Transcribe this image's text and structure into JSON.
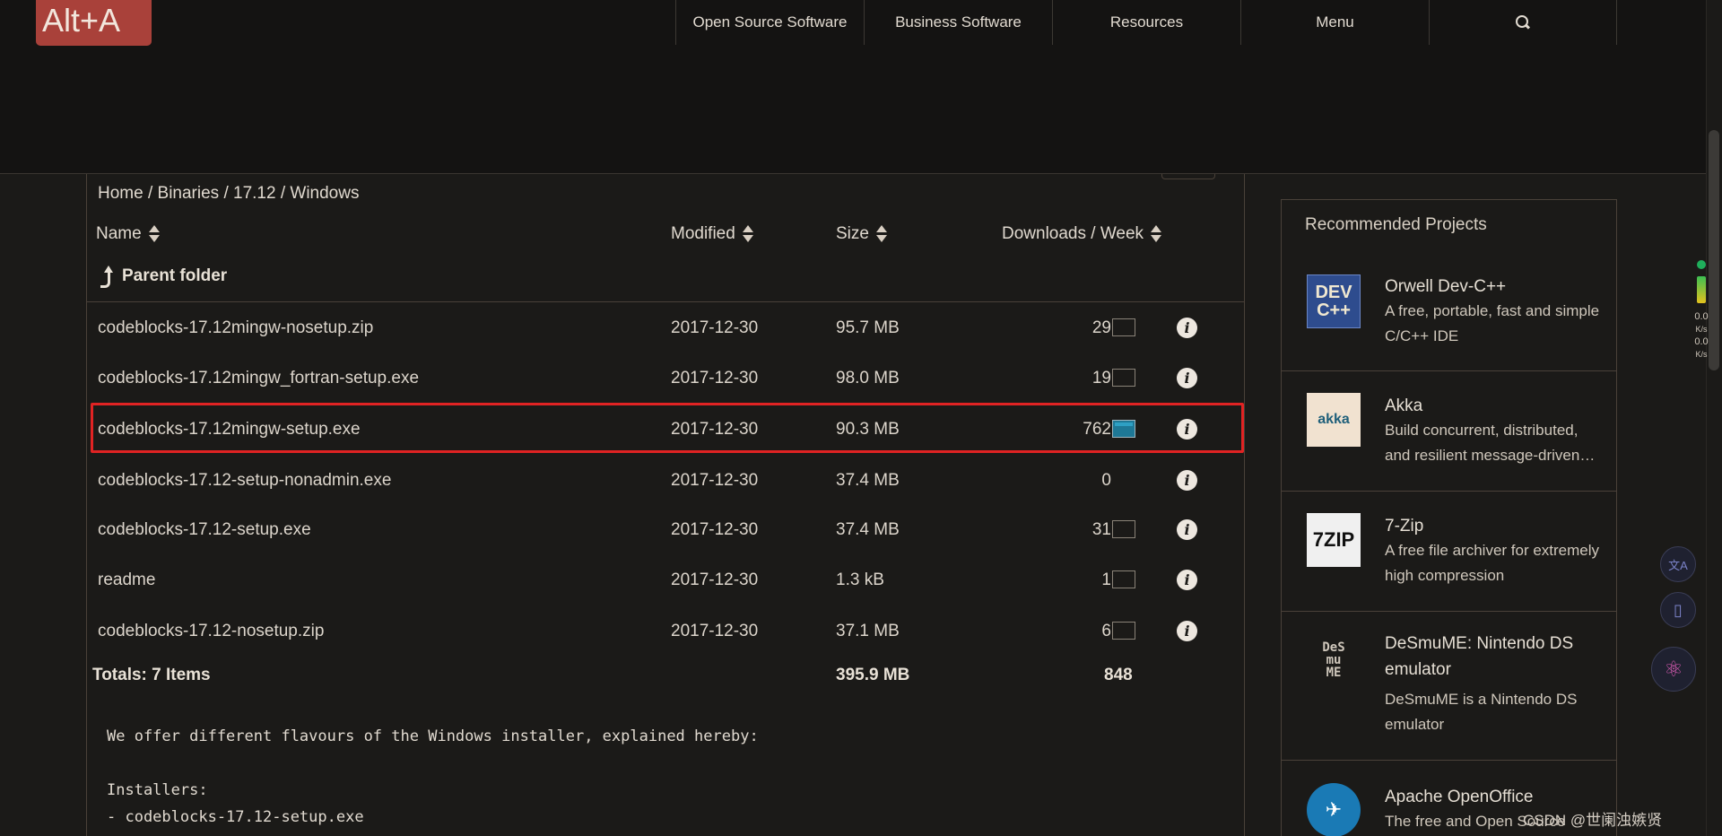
{
  "logo": "Alt+A",
  "nav": {
    "items": [
      "Open Source Software",
      "Business Software",
      "Resources",
      "Menu"
    ]
  },
  "breadcrumb": "Home / Binaries / 17.12 / Windows",
  "columns": {
    "name": "Name",
    "modified": "Modified",
    "size": "Size",
    "downloads": "Downloads / Week"
  },
  "parent_folder": "Parent folder",
  "files": [
    {
      "name": "codeblocks-17.12mingw-nosetup.zip",
      "modified": "2017-12-30",
      "size": "95.7 MB",
      "downloads": "29"
    },
    {
      "name": "codeblocks-17.12mingw_fortran-setup.exe",
      "modified": "2017-12-30",
      "size": "98.0 MB",
      "downloads": "19"
    },
    {
      "name": "codeblocks-17.12mingw-setup.exe",
      "modified": "2017-12-30",
      "size": "90.3 MB",
      "downloads": "762"
    },
    {
      "name": "codeblocks-17.12-setup-nonadmin.exe",
      "modified": "2017-12-30",
      "size": "37.4 MB",
      "downloads": "0"
    },
    {
      "name": "codeblocks-17.12-setup.exe",
      "modified": "2017-12-30",
      "size": "37.4 MB",
      "downloads": "31"
    },
    {
      "name": "readme",
      "modified": "2017-12-30",
      "size": "1.3 kB",
      "downloads": "1"
    },
    {
      "name": "codeblocks-17.12-nosetup.zip",
      "modified": "2017-12-30",
      "size": "37.1 MB",
      "downloads": "6"
    }
  ],
  "info_glyph": "i",
  "totals": {
    "label": "Totals: 7 Items",
    "size": "395.9 MB",
    "downloads": "848"
  },
  "readme": {
    "line1": "We offer different flavours of the Windows installer, explained hereby:",
    "line2": "Installers:",
    "line3": "- codeblocks-17.12-setup.exe"
  },
  "sidebar": {
    "title": "Recommended Projects",
    "projects": [
      {
        "name": "Orwell Dev-C++",
        "desc": "A free, portable, fast and simple C/C++ IDE",
        "thumb_top": "DEV",
        "thumb_bottom": "C++"
      },
      {
        "name": "Akka",
        "desc": "Build concurrent, distributed, and resilient message-driven…",
        "thumb": "akka"
      },
      {
        "name": "7-Zip",
        "desc": "A free file archiver for extremely high compression",
        "thumb": "7ZIP"
      },
      {
        "name": "DeSmuME: Nintendo DS emulator",
        "desc": "DeSmuME is a Nintendo DS emulator",
        "thumb_lines": [
          "DeS",
          "mu",
          "ME"
        ]
      },
      {
        "name": "Apache OpenOffice",
        "desc": "The free and Open Source",
        "thumb": "✈"
      }
    ]
  },
  "speed": {
    "up": "0.0",
    "up_unit": "K/s",
    "down": "0.0",
    "down_unit": "K/s"
  },
  "side_buttons": [
    "文A",
    "▯",
    "⚛"
  ],
  "watermark": "CSDN @世阑浊嫉贤",
  "colors": {
    "highlight": "#e02323",
    "logo_bg": "#a9413a",
    "spark_active": "#1e7896"
  }
}
